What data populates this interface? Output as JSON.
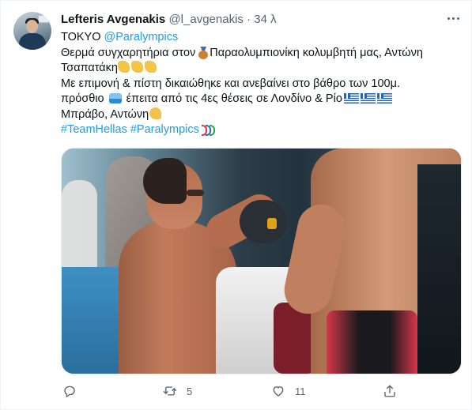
{
  "tweet": {
    "author_name": "Lefteris Avgenakis",
    "author_handle": "@l_avgenakis",
    "separator": "·",
    "time": "34 λ",
    "lines": {
      "l1_prefix": "TOKYO ",
      "l1_mention": "@Paralympics",
      "l2_text": "Θερμά συγχαρητήρια στον ",
      "l2_after": "Παραολυμπιονίκη κολυμβητή μας, Αντώνη",
      "l3_text": "Τσαπατάκη",
      "l4_text": "Με επιμονή & πίστη δικαιώθηκε και ανεβαίνει στο βάθρο των 100μ.",
      "l5_a": "πρόσθιο ",
      "l5_b": " έπειτα από τις 4ες θέσεις σε Λονδίνο & Ρίο",
      "l6_text": "Μπράβο, Αντώνη",
      "l7_tag1": "#TeamHellas",
      "l7_tag2": "#Paralympics"
    },
    "emoji": [
      "bronze-medal",
      "clapping-hands",
      "swimmer",
      "greek-flag",
      "flexed-biceps",
      "paralympics-logo"
    ],
    "photo_alt": "Swimmers at the Tokyo Paralympics pool"
  },
  "actions": {
    "reply_count": "",
    "retweet_count": "5",
    "like_count": "11",
    "share_count": ""
  },
  "colors": {
    "link": "#1d9bf0",
    "text": "#0f1419",
    "muted": "#536471",
    "border": "#eff3f4"
  },
  "icons": [
    "more-icon",
    "reply-icon",
    "retweet-icon",
    "like-icon",
    "share-icon"
  ]
}
